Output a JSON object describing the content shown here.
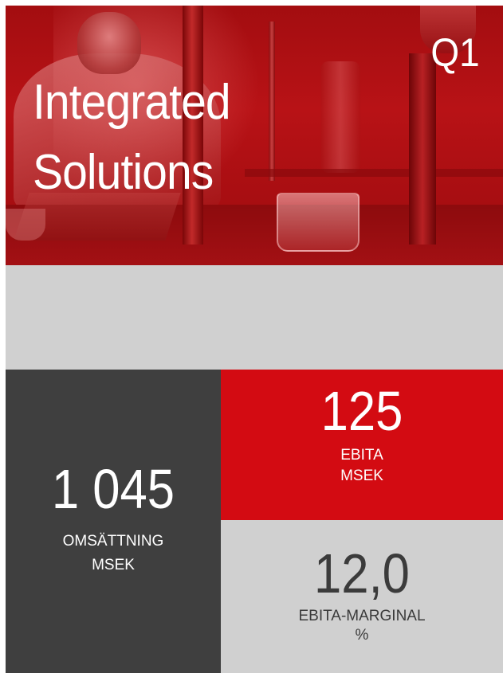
{
  "hero": {
    "title_line1": "Integrated",
    "title_line2": "Solutions",
    "quarter": "Q1"
  },
  "kpis": {
    "revenue": {
      "value": "1 045",
      "label_line1": "OMSÄTTNING",
      "label_line2": "MSEK"
    },
    "ebita": {
      "value": "125",
      "label_line1": "EBITA",
      "label_line2": "MSEK"
    },
    "margin": {
      "value": "12,0",
      "label_line1": "EBITA-MARGINAL",
      "label_line2": "%"
    }
  },
  "colors": {
    "brand_red": "#d30b12",
    "dark_panel": "#3f3f3f",
    "light_gray": "#d0d0d0"
  }
}
